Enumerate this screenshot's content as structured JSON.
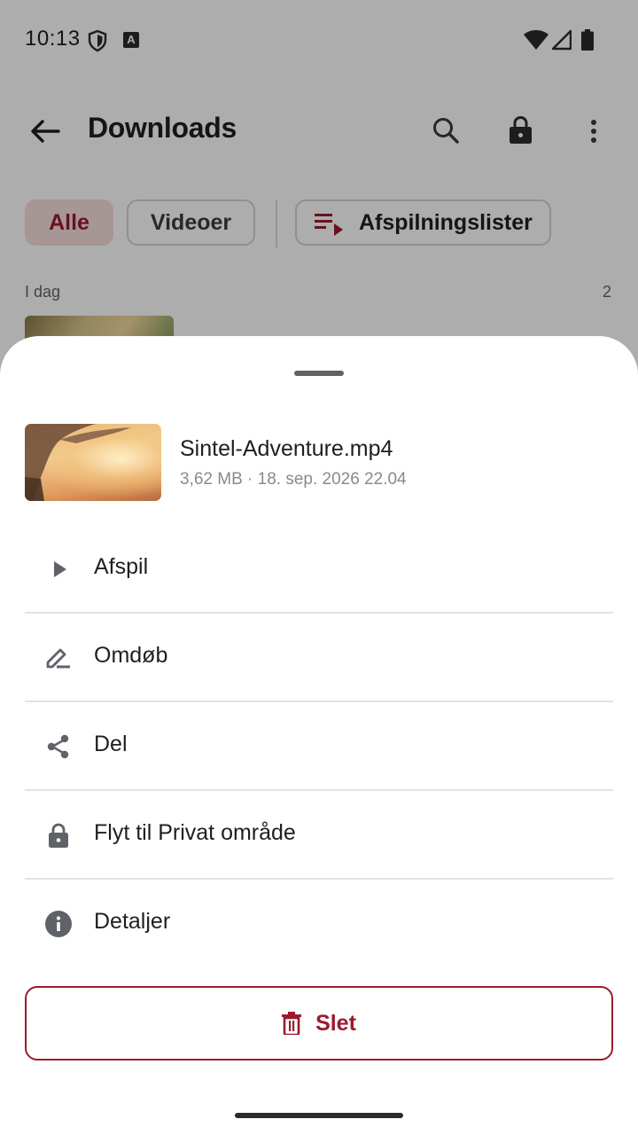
{
  "status_bar": {
    "time": "10:13",
    "a_badge": "A"
  },
  "app_bar": {
    "title": "Downloads"
  },
  "chips": {
    "all": "Alle",
    "videos": "Videoer",
    "playlists": "Afspilningslister"
  },
  "section": {
    "label": "I dag",
    "count": "2"
  },
  "sheet": {
    "file_name": "Sintel-Adventure.mp4",
    "file_meta": "3,62 MB · 18. sep. 2026 22.04",
    "items": [
      {
        "label": "Afspil",
        "icon": "play-icon"
      },
      {
        "label": "Omdøb",
        "icon": "rename-icon"
      },
      {
        "label": "Del",
        "icon": "share-icon"
      },
      {
        "label": "Flyt til Privat område",
        "icon": "lock-icon"
      },
      {
        "label": "Detaljer",
        "icon": "info-icon"
      }
    ],
    "delete_label": "Slet"
  },
  "colors": {
    "accent": "#9b1b2e",
    "chip_selected_bg": "#f7dede",
    "icon_gray": "#5f6368"
  }
}
